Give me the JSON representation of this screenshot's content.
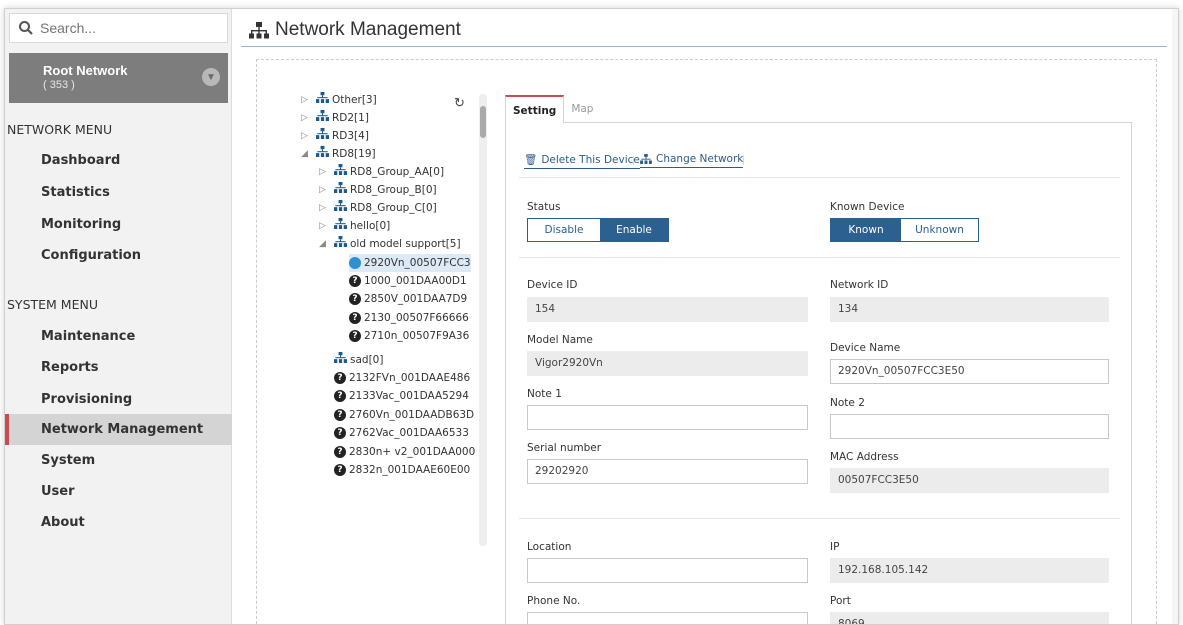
{
  "sidebar": {
    "search_placeholder": "Search...",
    "root": {
      "title": "Root Network",
      "count": "( 353 )"
    },
    "network_menu_title": "NETWORK MENU",
    "network_menu": [
      "Dashboard",
      "Statistics",
      "Monitoring",
      "Configuration"
    ],
    "system_menu_title": "SYSTEM MENU",
    "system_menu": [
      "Maintenance",
      "Reports",
      "Provisioning",
      "Network Management",
      "System",
      "User",
      "About"
    ],
    "active_item": "Network Management"
  },
  "header": {
    "title": "Network Management"
  },
  "tree": {
    "items": [
      {
        "label": "Other[3]"
      },
      {
        "label": "RD2[1]"
      },
      {
        "label": "RD3[4]"
      },
      {
        "label": "RD8[19]"
      },
      {
        "label": "RD8_Group_AA[0]"
      },
      {
        "label": "RD8_Group_B[0]"
      },
      {
        "label": "RD8_Group_C[0]"
      },
      {
        "label": "hello[0]"
      },
      {
        "label": "old model support[5]"
      },
      {
        "label": "2920Vn_00507FCC3"
      },
      {
        "label": "1000_001DAA00D1"
      },
      {
        "label": "2850V_001DAA7D9"
      },
      {
        "label": "2130_00507F66666"
      },
      {
        "label": "2710n_00507F9A36"
      },
      {
        "label": "sad[0]"
      },
      {
        "label": "2132FVn_001DAAE486"
      },
      {
        "label": "2133Vac_001DAA5294"
      },
      {
        "label": "2760Vn_001DAADB63D"
      },
      {
        "label": "2762Vac_001DAA6533"
      },
      {
        "label": "2830n+ v2_001DAA000"
      },
      {
        "label": "2832n_001DAAE60E00"
      }
    ]
  },
  "tabs": {
    "setting": "Setting",
    "map": "Map"
  },
  "actions": {
    "delete": "Delete This Device",
    "change": "Change Network"
  },
  "status": {
    "label": "Status",
    "disable": "Disable",
    "enable": "Enable",
    "value": "Enable"
  },
  "known": {
    "label": "Known Device",
    "known": "Known",
    "unknown": "Unknown",
    "value": "Known"
  },
  "fields": {
    "device_id": {
      "label": "Device ID",
      "value": "154"
    },
    "network_id": {
      "label": "Network ID",
      "value": "134"
    },
    "model_name": {
      "label": "Model Name",
      "value": "Vigor2920Vn"
    },
    "device_name": {
      "label": "Device Name",
      "value": "2920Vn_00507FCC3E50"
    },
    "note1": {
      "label": "Note 1",
      "value": ""
    },
    "note2": {
      "label": "Note 2",
      "value": ""
    },
    "serial": {
      "label": "Serial number",
      "value": "29202920"
    },
    "mac": {
      "label": "MAC Address",
      "value": "00507FCC3E50"
    },
    "location": {
      "label": "Location",
      "value": ""
    },
    "ip": {
      "label": "IP",
      "value": "192.168.105.142"
    },
    "phone": {
      "label": "Phone No.",
      "value": ""
    },
    "port": {
      "label": "Port",
      "value": "8069"
    }
  },
  "colors": {
    "accent": "#2c6091",
    "active_bar": "#cc4b50",
    "sidebar_bg": "#f2f2f2",
    "root_bg": "#7d7d7d"
  }
}
